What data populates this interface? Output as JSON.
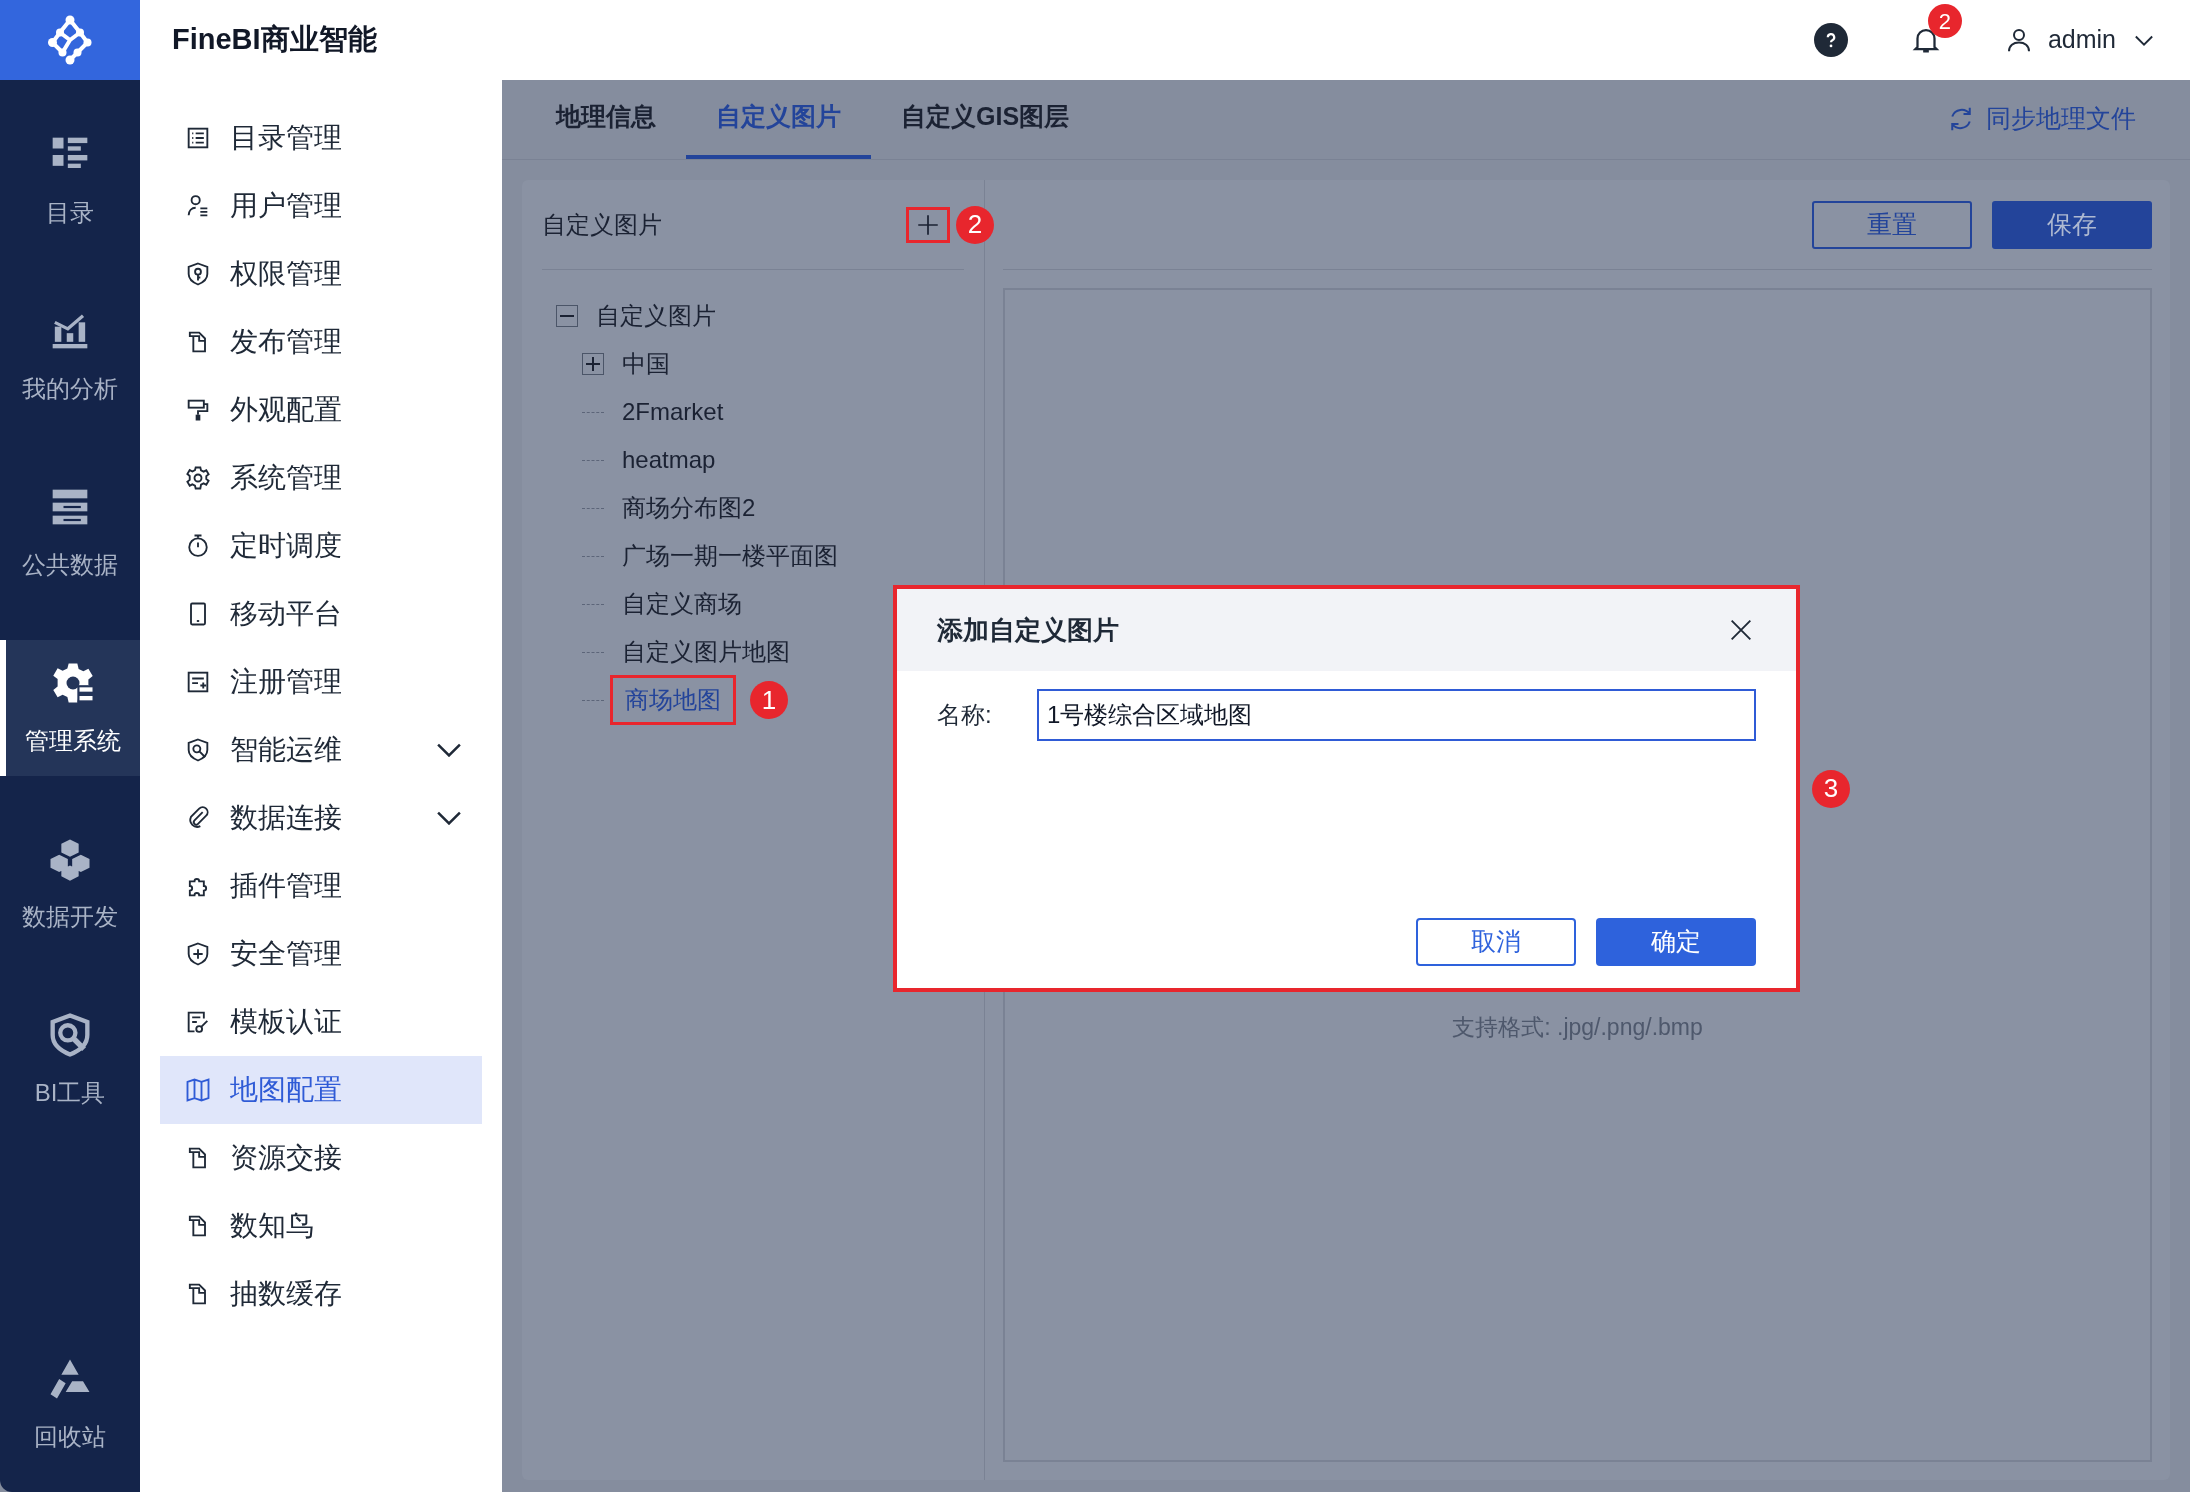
{
  "app": {
    "title": "FineBI商业智能"
  },
  "header": {
    "notifications": "2",
    "user": "admin"
  },
  "rail": {
    "items": [
      {
        "label": "目录",
        "selected": false
      },
      {
        "label": "我的分析",
        "selected": false
      },
      {
        "label": "公共数据",
        "selected": false
      },
      {
        "label": "管理系统",
        "selected": true
      },
      {
        "label": "数据开发",
        "selected": false
      },
      {
        "label": "BI工具",
        "selected": false
      }
    ],
    "bottom_item": {
      "label": "回收站",
      "selected": false
    }
  },
  "menu": [
    {
      "label": "目录管理",
      "selected": false,
      "has_submenu": false
    },
    {
      "label": "用户管理",
      "selected": false,
      "has_submenu": false
    },
    {
      "label": "权限管理",
      "selected": false,
      "has_submenu": false
    },
    {
      "label": "发布管理",
      "selected": false,
      "has_submenu": false
    },
    {
      "label": "外观配置",
      "selected": false,
      "has_submenu": false
    },
    {
      "label": "系统管理",
      "selected": false,
      "has_submenu": false
    },
    {
      "label": "定时调度",
      "selected": false,
      "has_submenu": false
    },
    {
      "label": "移动平台",
      "selected": false,
      "has_submenu": false
    },
    {
      "label": "注册管理",
      "selected": false,
      "has_submenu": false
    },
    {
      "label": "智能运维",
      "selected": false,
      "has_submenu": true
    },
    {
      "label": "数据连接",
      "selected": false,
      "has_submenu": true
    },
    {
      "label": "插件管理",
      "selected": false,
      "has_submenu": false
    },
    {
      "label": "安全管理",
      "selected": false,
      "has_submenu": false
    },
    {
      "label": "模板认证",
      "selected": false,
      "has_submenu": false
    },
    {
      "label": "地图配置",
      "selected": true,
      "has_submenu": false
    },
    {
      "label": "资源交接",
      "selected": false,
      "has_submenu": false
    },
    {
      "label": "数知鸟",
      "selected": false,
      "has_submenu": false
    },
    {
      "label": "抽数缓存",
      "selected": false,
      "has_submenu": false
    }
  ],
  "tabs": [
    {
      "label": "地理信息",
      "selected": false
    },
    {
      "label": "自定义图片",
      "selected": true
    },
    {
      "label": "自定义GIS图层",
      "selected": false
    }
  ],
  "sync_button": "同步地理文件",
  "tree_panel": {
    "title": "自定义图片",
    "add_marker": "2",
    "tree": [
      {
        "label": "自定义图片",
        "expanded": true,
        "selected": false,
        "children": [
          {
            "label": "中国",
            "expanded": false,
            "selected": false
          },
          {
            "label": "2Fmarket",
            "selected": false
          },
          {
            "label": "heatmap",
            "selected": false
          },
          {
            "label": "商场分布图2",
            "selected": false
          },
          {
            "label": "广场一期一楼平面图",
            "selected": false
          },
          {
            "label": "自定义商场",
            "selected": false
          },
          {
            "label": "自定义图片地图",
            "selected": false
          },
          {
            "label": "商场地图",
            "selected": true,
            "marker": "1"
          }
        ]
      }
    ]
  },
  "editor": {
    "buttons": [
      {
        "label": "重置",
        "kind": "outline"
      },
      {
        "label": "保存",
        "kind": "primary"
      }
    ],
    "hint": "支持格式: .jpg/.png/.bmp"
  },
  "dialog": {
    "title": "添加自定义图片",
    "marker": "3",
    "field": {
      "label": "名称:",
      "value": "1号楼综合区域地图"
    },
    "buttons": [
      {
        "label": "取消",
        "kind": "outline"
      },
      {
        "label": "确定",
        "kind": "primary"
      }
    ]
  }
}
